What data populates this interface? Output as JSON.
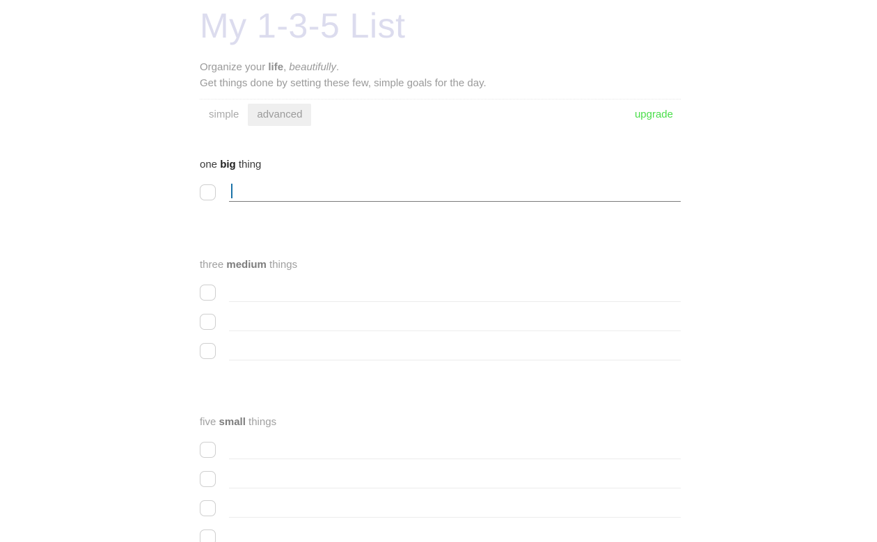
{
  "header": {
    "title": "My 1-3-5 List",
    "tagline_line1_pre": "Organize your ",
    "tagline_line1_bold": "life",
    "tagline_line1_mid": ", ",
    "tagline_line1_ital": "beautifully",
    "tagline_line1_post": ".",
    "tagline_line2": "Get things done by setting these few, simple goals for the day."
  },
  "toolbar": {
    "tabs": [
      {
        "label": "simple",
        "active": false
      },
      {
        "label": "advanced",
        "active": true
      }
    ],
    "upgrade_label": "upgrade"
  },
  "sections": [
    {
      "id": "big",
      "heading_pre": "one ",
      "heading_bold": "big",
      "heading_post": " thing",
      "rows": [
        {
          "checked": false,
          "value": "",
          "placeholder": "",
          "focused": true
        }
      ]
    },
    {
      "id": "medium",
      "heading_pre": "three ",
      "heading_bold": "medium",
      "heading_post": " things",
      "rows": [
        {
          "checked": false,
          "value": "",
          "placeholder": "",
          "focused": false
        },
        {
          "checked": false,
          "value": "",
          "placeholder": "",
          "focused": false
        },
        {
          "checked": false,
          "value": "",
          "placeholder": "",
          "focused": false
        }
      ]
    },
    {
      "id": "small",
      "heading_pre": "five ",
      "heading_bold": "small",
      "heading_post": " things",
      "rows": [
        {
          "checked": false,
          "value": "",
          "placeholder": "",
          "focused": false
        },
        {
          "checked": false,
          "value": "",
          "placeholder": "",
          "focused": false
        },
        {
          "checked": false,
          "value": "",
          "placeholder": "",
          "focused": false
        },
        {
          "checked": false,
          "value": "",
          "placeholder": "",
          "focused": false
        }
      ]
    }
  ],
  "colors": {
    "title": "#dcdcee",
    "upgrade": "#4ade4a",
    "caret": "#1a72a8",
    "tab_active_bg": "#efefef",
    "underline_focused": "#7b7b7b",
    "underline_idle": "#ececec",
    "checkbox_border": "#cfcfcf"
  }
}
